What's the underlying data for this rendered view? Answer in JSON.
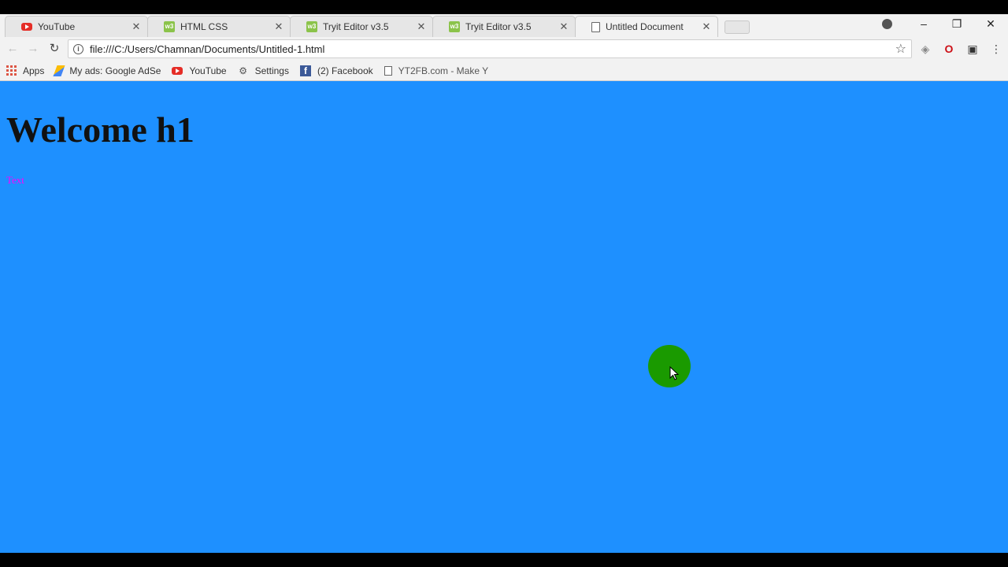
{
  "tabs": [
    {
      "title": "YouTube",
      "icon": "youtube-icon"
    },
    {
      "title": "HTML CSS",
      "icon": "w3schools-icon"
    },
    {
      "title": "Tryit Editor v3.5",
      "icon": "w3schools-icon"
    },
    {
      "title": "Tryit Editor v3.5",
      "icon": "w3schools-icon"
    },
    {
      "title": "Untitled Document",
      "icon": "document-icon",
      "active": true
    }
  ],
  "toolbar": {
    "url": "file:///C:/Users/Chamnan/Documents/Untitled-1.html"
  },
  "bookmarks": [
    {
      "label": "Apps",
      "icon": "apps-grid-icon"
    },
    {
      "label": "My ads: Google AdSe",
      "icon": "adsense-icon"
    },
    {
      "label": "YouTube",
      "icon": "youtube-icon"
    },
    {
      "label": "Settings",
      "icon": "gear-icon"
    },
    {
      "label": "(2) Facebook",
      "icon": "facebook-icon"
    },
    {
      "label": "YT2FB.com - Make Y",
      "icon": "document-icon"
    }
  ],
  "page": {
    "heading": "Welcome h1",
    "paragraph": "Text",
    "background_color": "#1e90ff",
    "paragraph_color": "#ff00ff"
  },
  "colors": {
    "cursor_highlight": "#1a9a00"
  }
}
